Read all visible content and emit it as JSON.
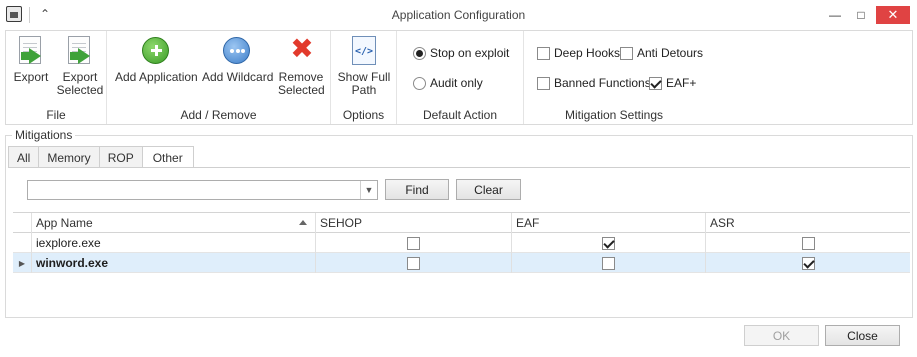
{
  "window": {
    "title": "Application Configuration",
    "collapse_glyph": "⌃",
    "min_glyph": "—",
    "max_glyph": "□",
    "close_glyph": "✕"
  },
  "ribbon": {
    "file": {
      "caption": "File",
      "export_label": "Export",
      "export_selected_label_1": "Export",
      "export_selected_label_2": "Selected"
    },
    "add_remove": {
      "caption": "Add / Remove",
      "add_application_label": "Add Application",
      "add_wildcard_label": "Add Wildcard",
      "remove_selected_label_1": "Remove",
      "remove_selected_label_2": "Selected"
    },
    "options": {
      "caption": "Options",
      "show_full_path_label_1": "Show Full",
      "show_full_path_label_2": "Path",
      "code_glyph": "</>"
    },
    "default_action": {
      "caption": "Default Action",
      "stop_on_exploit": "Stop on exploit",
      "audit_only": "Audit only",
      "selected": "stop_on_exploit"
    },
    "mitigation_settings": {
      "caption": "Mitigation Settings",
      "deep_hooks": {
        "label": "Deep Hooks",
        "checked": false
      },
      "anti_detours": {
        "label": "Anti Detours",
        "checked": false
      },
      "banned_functions": {
        "label": "Banned Functions",
        "checked": false
      },
      "eaf_plus": {
        "label": "EAF+",
        "checked": true
      }
    }
  },
  "mitigations": {
    "legend": "Mitigations",
    "tabs": [
      "All",
      "Memory",
      "ROP",
      "Other"
    ],
    "active_tab": "Other",
    "search": {
      "value": "",
      "placeholder": ""
    },
    "find_label": "Find",
    "clear_label": "Clear",
    "dropdown_glyph": "▼",
    "grid": {
      "columns": [
        "App Name",
        "SEHOP",
        "EAF",
        "ASR"
      ],
      "rows": [
        {
          "name": "iexplore.exe",
          "sehop": false,
          "eaf": true,
          "asr": false,
          "selected": false
        },
        {
          "name": "winword.exe",
          "sehop": false,
          "eaf": false,
          "asr": true,
          "selected": true
        }
      ],
      "row_indicator_glyph": "▶"
    }
  },
  "footer": {
    "ok_label": "OK",
    "close_label": "Close"
  },
  "colors": {
    "close_button": "#e04343",
    "selected_row": "#dfeefb",
    "icon_green": "#3fa23a",
    "icon_blue": "#3d7ec9",
    "icon_red": "#e23a2c"
  }
}
